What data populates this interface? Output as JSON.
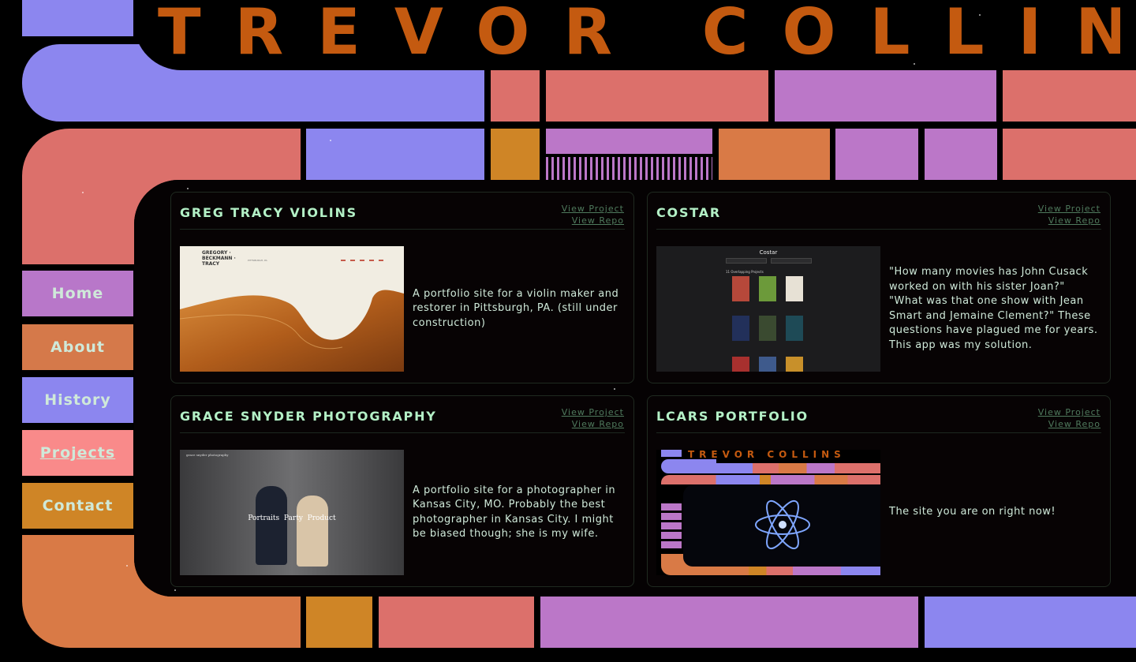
{
  "site": {
    "title": "TREVOR COLLINS"
  },
  "nav": {
    "items": [
      {
        "label": "Home",
        "color": "#b877c9",
        "active": false
      },
      {
        "label": "About",
        "color": "#d5794a",
        "active": false
      },
      {
        "label": "History",
        "color": "#8c86ef",
        "active": false
      },
      {
        "label": "Projects",
        "color": "#f98a8a",
        "active": true
      },
      {
        "label": "Contact",
        "color": "#cf8526",
        "active": false
      }
    ]
  },
  "projects": [
    {
      "title": "GREG TRACY VIOLINS",
      "view_project": "View Project",
      "view_repo": "View Repo",
      "description": "A portfolio site for a violin maker and restorer in Pittsburgh, PA. (still under construction)",
      "thumb": {
        "brand": "GREGORY · BECKMANN · TRACY",
        "sub": "PITTSBURGH, PA"
      }
    },
    {
      "title": "COSTAR",
      "view_project": "View Project",
      "view_repo": "View Repo",
      "description": "\"How many movies has John Cusack worked on with his sister Joan?\" \"What was that one show with Jean Smart and Jemaine Clement?\" These questions have plagued me for years. This app was my solution.",
      "thumb": {
        "app_title": "Costar",
        "section": "11 Overlapping Projects"
      }
    },
    {
      "title": "GRACE SNYDER PHOTOGRAPHY",
      "view_project": "View Project",
      "view_repo": "View Repo",
      "description": "A portfolio site for a photographer in Kansas City, MO. Probably the best photographer in Kansas City. I might be biased though; she is my wife.",
      "thumb": {
        "site_name": "grace snyder photography",
        "overlay": "Portraits  Party  Product"
      }
    },
    {
      "title": "LCARS PORTFOLIO",
      "view_project": "View Project",
      "view_repo": "View Repo",
      "description": "The site you are on right now!",
      "thumb": {
        "mini_title": "TREVOR COLLINS"
      }
    }
  ],
  "colors": {
    "periwinkle": "#8c86ef",
    "salmon": "#dc706b",
    "orchid": "#bb77c8",
    "orange": "#d97a46",
    "amber": "#cf8526",
    "title": "#c45a10",
    "text": "#cfe9d9",
    "heading": "#b3f0c6"
  },
  "icons": {
    "atom": "atom-icon"
  }
}
